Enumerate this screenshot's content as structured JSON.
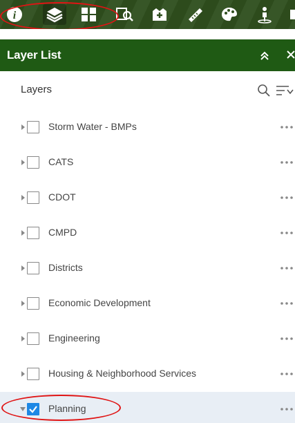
{
  "toolbar": {
    "tools": [
      {
        "icon": "info-icon",
        "active": false
      },
      {
        "icon": "layers-icon",
        "active": true
      },
      {
        "icon": "grid-icon",
        "active": false
      },
      {
        "icon": "search-map-icon",
        "active": false
      },
      {
        "icon": "add-data-icon",
        "active": false
      },
      {
        "icon": "measure-icon",
        "active": false
      },
      {
        "icon": "palette-icon",
        "active": false
      },
      {
        "icon": "person-icon",
        "active": false
      },
      {
        "icon": "more-tool-icon",
        "active": false
      }
    ]
  },
  "panel": {
    "title": "Layer List"
  },
  "layers_section": {
    "label": "Layers"
  },
  "layers": [
    {
      "label": "Storm Water - BMPs",
      "checked": false,
      "expanded": false,
      "selected": false
    },
    {
      "label": "CATS",
      "checked": false,
      "expanded": false,
      "selected": false
    },
    {
      "label": "CDOT",
      "checked": false,
      "expanded": false,
      "selected": false
    },
    {
      "label": "CMPD",
      "checked": false,
      "expanded": false,
      "selected": false
    },
    {
      "label": "Districts",
      "checked": false,
      "expanded": false,
      "selected": false
    },
    {
      "label": "Economic Development",
      "checked": false,
      "expanded": false,
      "selected": false
    },
    {
      "label": "Engineering",
      "checked": false,
      "expanded": false,
      "selected": false
    },
    {
      "label": "Housing & Neighborhood Services",
      "checked": false,
      "expanded": false,
      "selected": false
    },
    {
      "label": "Planning",
      "checked": true,
      "expanded": true,
      "selected": true
    }
  ],
  "colors": {
    "toolbar_bg": "#2f4f1e",
    "header_bg": "#1f5a14",
    "checkbox_checked": "#1e88e5",
    "highlight_ring": "#e01414",
    "selected_row": "#e8eef5"
  }
}
